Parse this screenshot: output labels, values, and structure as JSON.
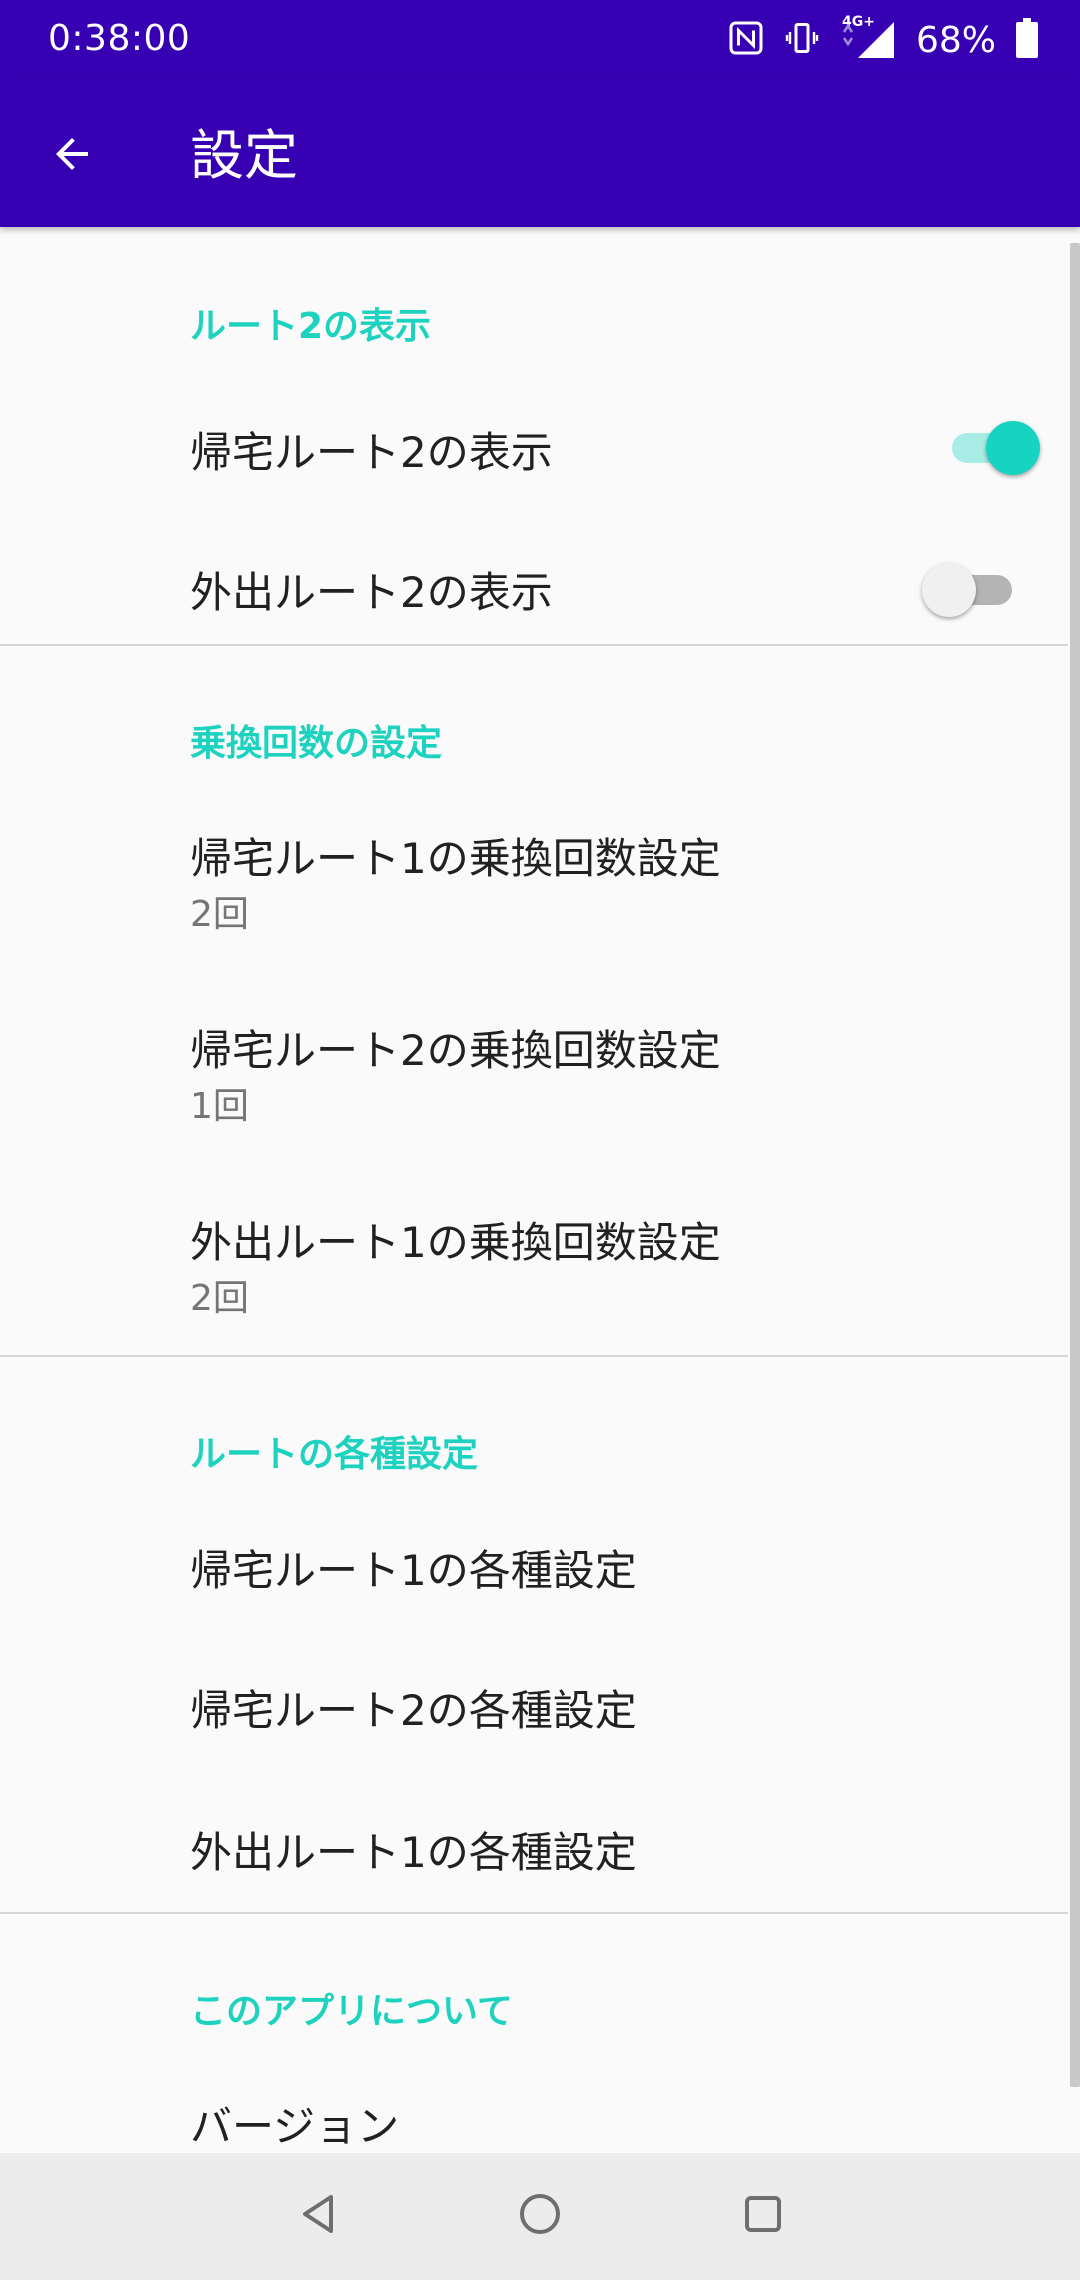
{
  "status_bar": {
    "time": "0:38:00",
    "network": "4G+",
    "battery_percent": "68%",
    "icons": [
      "nfc-icon",
      "vibrate-icon",
      "signal-icon",
      "battery-icon"
    ]
  },
  "app_bar": {
    "title": "設定",
    "back_icon": "arrow-back-icon"
  },
  "colors": {
    "primary": "#3700b3",
    "accent": "#1ed2c0",
    "switch_on": "#17d4c1"
  },
  "sections": [
    {
      "title": "ルート2の表示",
      "items": [
        {
          "title": "帰宅ルート2の表示",
          "switch_on": true
        },
        {
          "title": "外出ルート2の表示",
          "switch_on": false
        }
      ]
    },
    {
      "title": "乗換回数の設定",
      "items": [
        {
          "title": "帰宅ルート1の乗換回数設定",
          "summary": "2回"
        },
        {
          "title": "帰宅ルート2の乗換回数設定",
          "summary": "1回"
        },
        {
          "title": "外出ルート1の乗換回数設定",
          "summary": "2回"
        }
      ]
    },
    {
      "title": "ルートの各種設定",
      "items": [
        {
          "title": "帰宅ルート1の各種設定"
        },
        {
          "title": "帰宅ルート2の各種設定"
        },
        {
          "title": "外出ルート1の各種設定"
        }
      ]
    },
    {
      "title": "このアプリについて",
      "items": [
        {
          "title": "バージョン"
        }
      ]
    }
  ],
  "nav_bar": {
    "buttons": [
      "back-triangle-icon",
      "home-circle-icon",
      "recents-square-icon"
    ]
  }
}
